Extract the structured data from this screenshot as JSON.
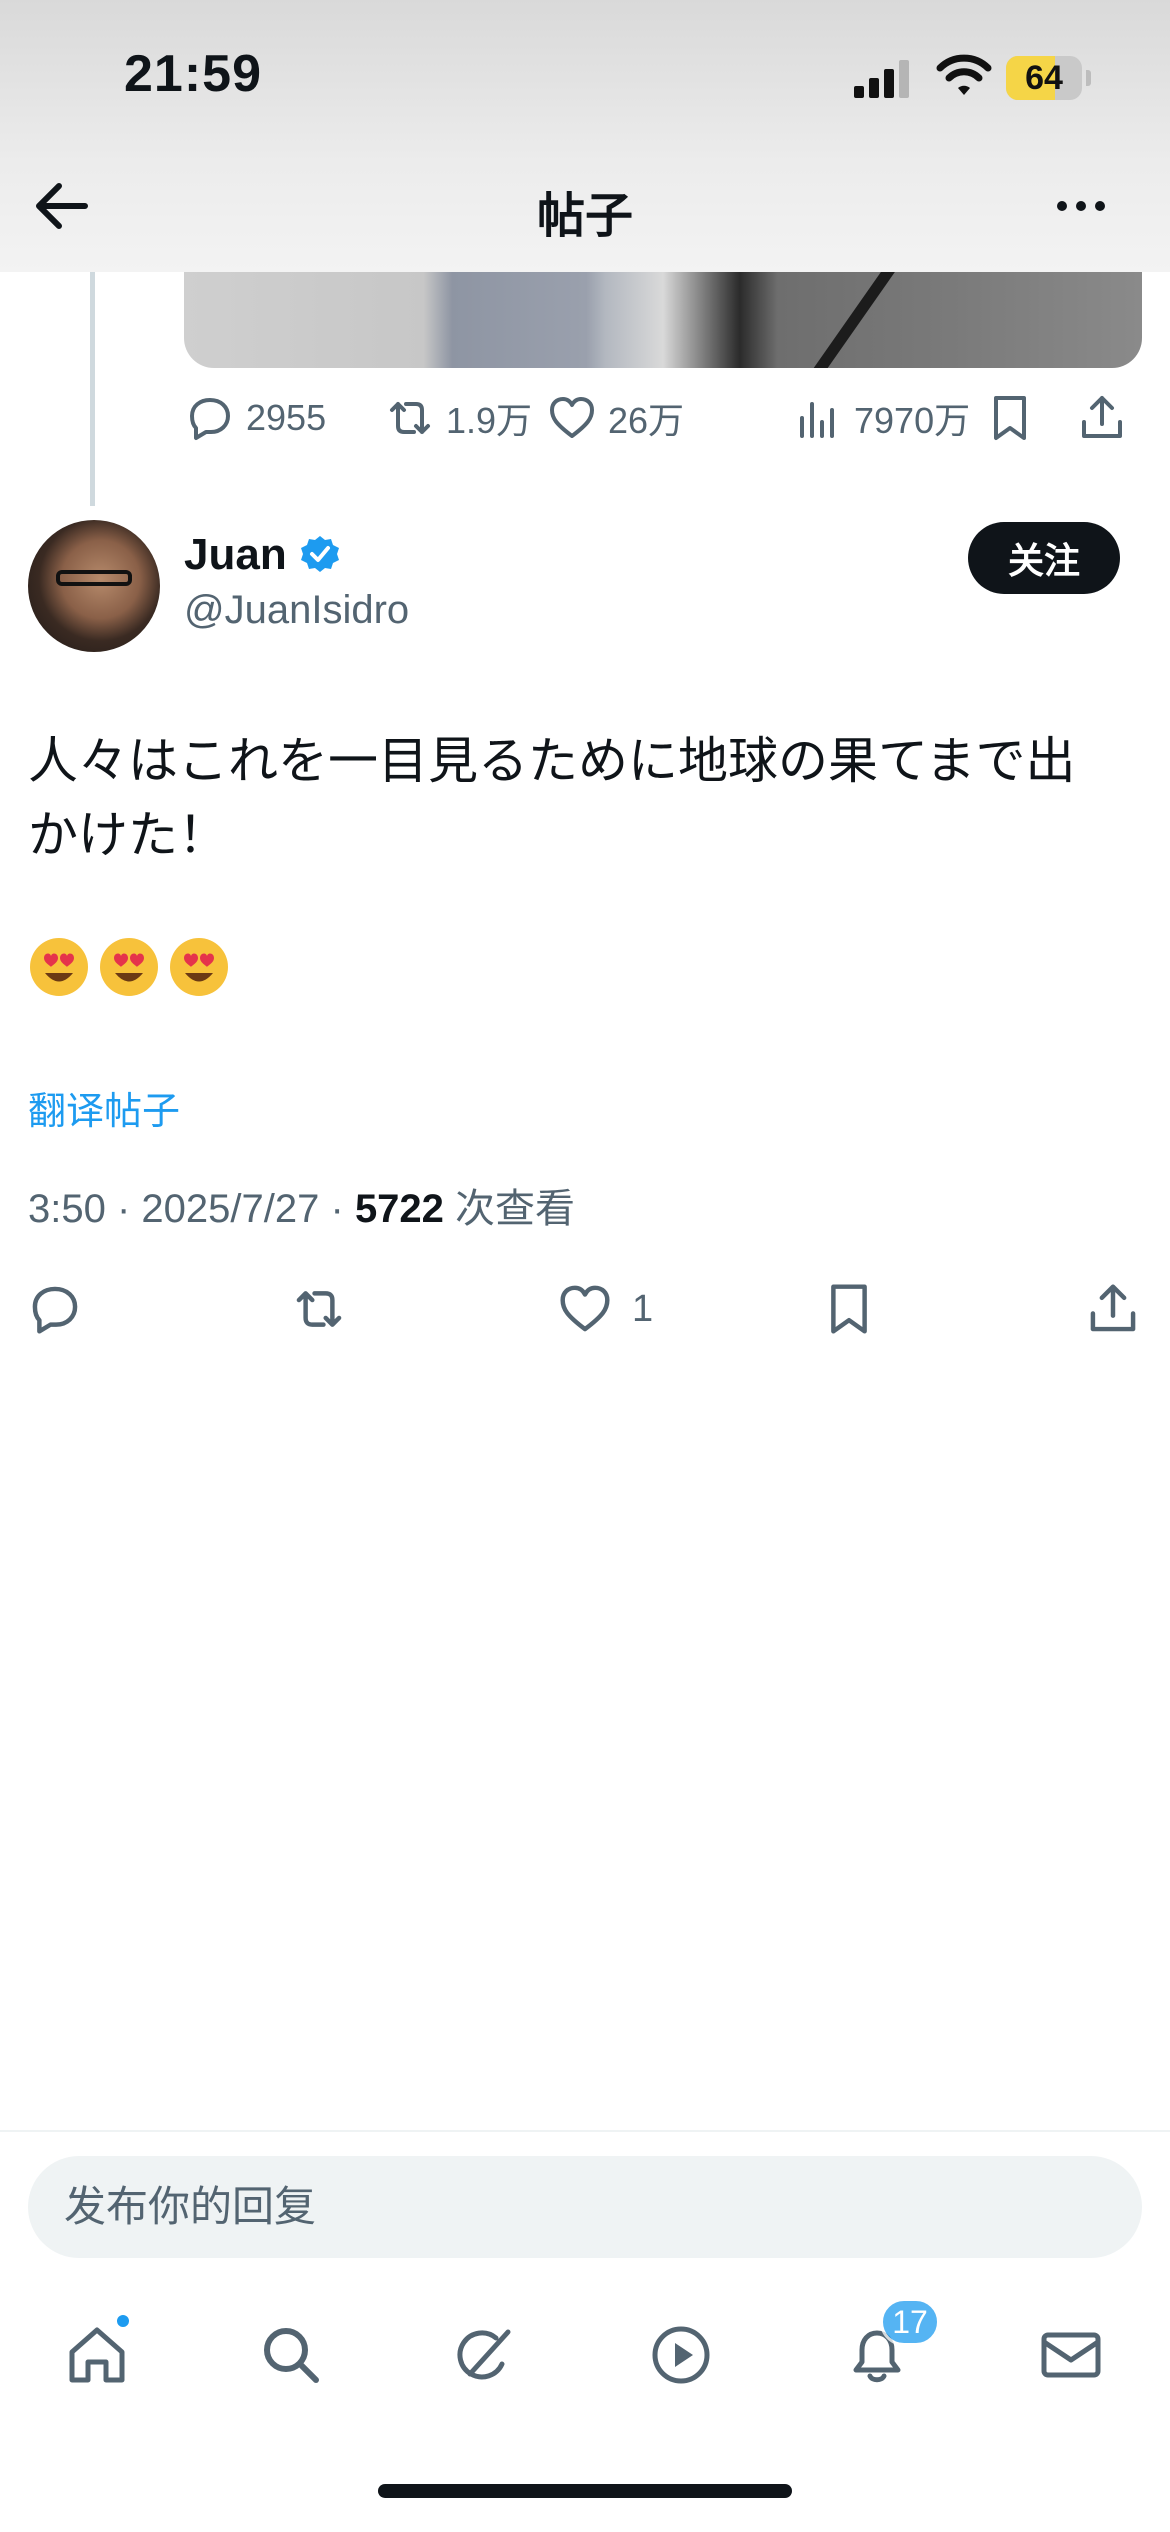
{
  "status_bar": {
    "time": "21:59",
    "battery_percent": "64",
    "battery_level": 0.64,
    "battery_color": "#f5d547"
  },
  "header": {
    "title": "帖子",
    "back_icon": "arrow-left-icon",
    "more_icon": "more-horizontal-icon"
  },
  "previous_post": {
    "replies": "2955",
    "reposts": "1.9万",
    "likes": "26万",
    "views": "7970万"
  },
  "post": {
    "author_name": "Juan",
    "author_handle": "@JuanIsidro",
    "verified": true,
    "follow_label": "关注",
    "text": "人々はこれを一目見るために地球の果てまで出\nかけた！",
    "emojis": [
      "😍",
      "😍",
      "😍"
    ],
    "translate_label": "翻译帖子",
    "time": "3:50",
    "date": "2025/7/27",
    "view_count": "5722",
    "views_label": "次查看",
    "like_count": "1"
  },
  "reply_bar": {
    "placeholder": "发布你的回复"
  },
  "bottom_nav": {
    "items": [
      "home-icon",
      "search-icon",
      "grok-icon",
      "video-play-icon",
      "notifications-bell-icon",
      "messages-mail-icon"
    ],
    "notification_badge": "17"
  },
  "colors": {
    "accent": "#1d9bf0",
    "text_primary": "#0f1419",
    "text_secondary": "#536471"
  }
}
